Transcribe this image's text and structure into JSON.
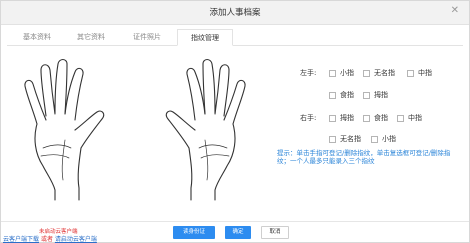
{
  "dialog": {
    "title": "添加人事档案"
  },
  "tabs": [
    "基本资料",
    "其它资料",
    "证件照片",
    "指纹管理"
  ],
  "left_hand": {
    "label": "左手:",
    "options": [
      "小指",
      "无名指",
      "中指",
      "食指",
      "拇指"
    ]
  },
  "right_hand": {
    "label": "右手:",
    "options": [
      "拇指",
      "食指",
      "中指",
      "无名指",
      "小指"
    ]
  },
  "tip": "提示：单击手指可登记/删除指纹，单击复选框可登记/删除指纹；一个人最多只能录入三个指纹",
  "footer": {
    "not_started": "未启动云客户端",
    "download_link": "云客户端下载",
    "or": "或者",
    "start_link": "请启动云客户端",
    "read_id_button": "读身份证",
    "confirm_button": "确定",
    "cancel_button": "取消"
  }
}
